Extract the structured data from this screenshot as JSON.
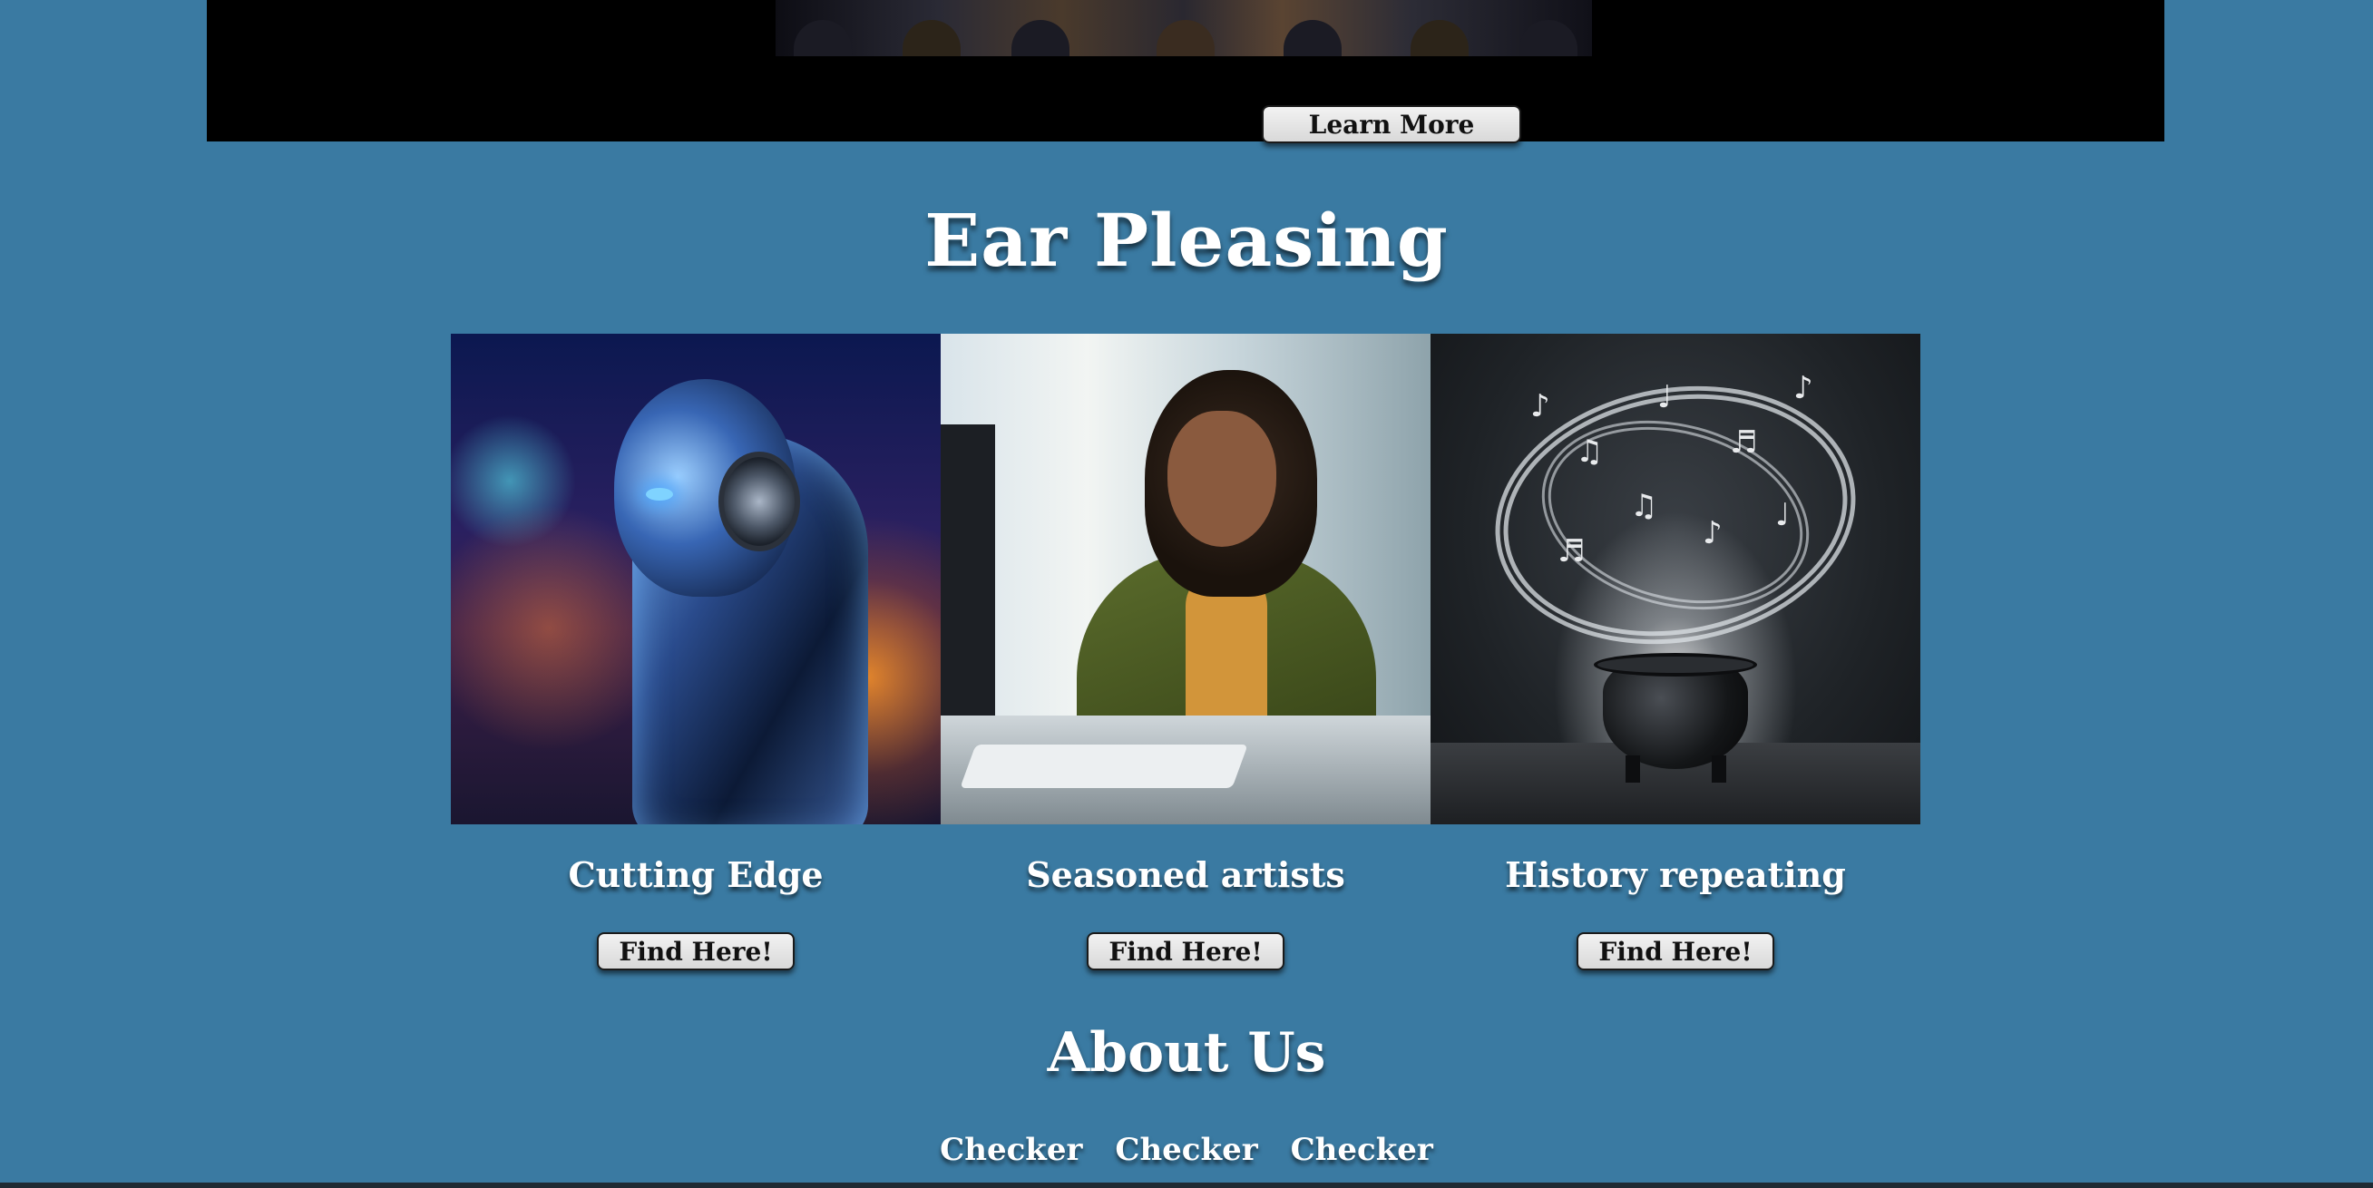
{
  "hero": {
    "learn_more_label": "Learn More"
  },
  "section": {
    "title": "Ear Pleasing"
  },
  "cards": [
    {
      "title": "Cutting Edge",
      "button_label": "Find Here!"
    },
    {
      "title": "Seasoned artists",
      "button_label": "Find Here!"
    },
    {
      "title": "History repeating",
      "button_label": "Find Here!"
    }
  ],
  "about": {
    "title": "About Us",
    "links": [
      "Checker",
      "Checker",
      "Checker"
    ]
  },
  "colors": {
    "background": "#3a7aa2",
    "hero_background": "#000000",
    "button_background": "#e6e6e6",
    "heading_text": "#ffffff"
  }
}
